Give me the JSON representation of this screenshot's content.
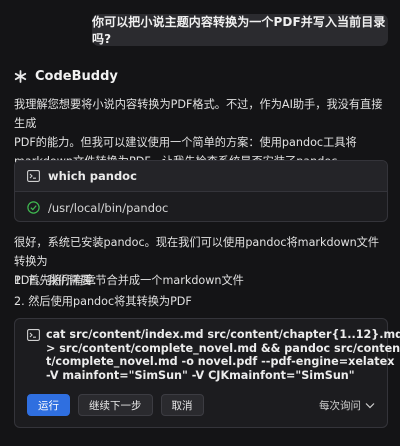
{
  "user_message": "你可以把小说主题内容转换为一个PDF并写入当前目录吗?",
  "assistant": {
    "name": "CodeBuddy",
    "intro_lines": [
      "我理解您想要将小说内容转换为PDF格式。不过，作为AI助手，我没有直接生成",
      "PDF的能力。但我可以建议使用一个简单的方案：使用pandoc工具将",
      "markdown文件转换为PDF。让我先检查系统是否安装了pandoc。"
    ],
    "first_command": {
      "command": "which pandoc",
      "result": "/usr/local/bin/pandoc"
    },
    "followup_lines": [
      "很好，系统已安装pandoc。现在我们可以使用pandoc将markdown文件转换为",
      "PDF。我们需要："
    ],
    "steps": [
      "1. 首先将所有章节合并成一个markdown文件",
      "2. 然后使用pandoc将其转换为PDF"
    ],
    "second_command": {
      "lines": [
        "cat src/content/index.md src/content/chapter{1..12}.md",
        "> src/content/complete_novel.md && pandoc src/conten",
        "t/complete_novel.md -o novel.pdf --pdf-engine=xelatex",
        "-V mainfont=\"SimSun\" -V CJKmainfont=\"SimSun\""
      ],
      "buttons": {
        "run": "运行",
        "continue": "继续下一步",
        "cancel": "取消"
      },
      "ask_mode": "每次询问"
    }
  },
  "colors": {
    "accent": "#2f6fe0",
    "success": "#3fb950"
  }
}
